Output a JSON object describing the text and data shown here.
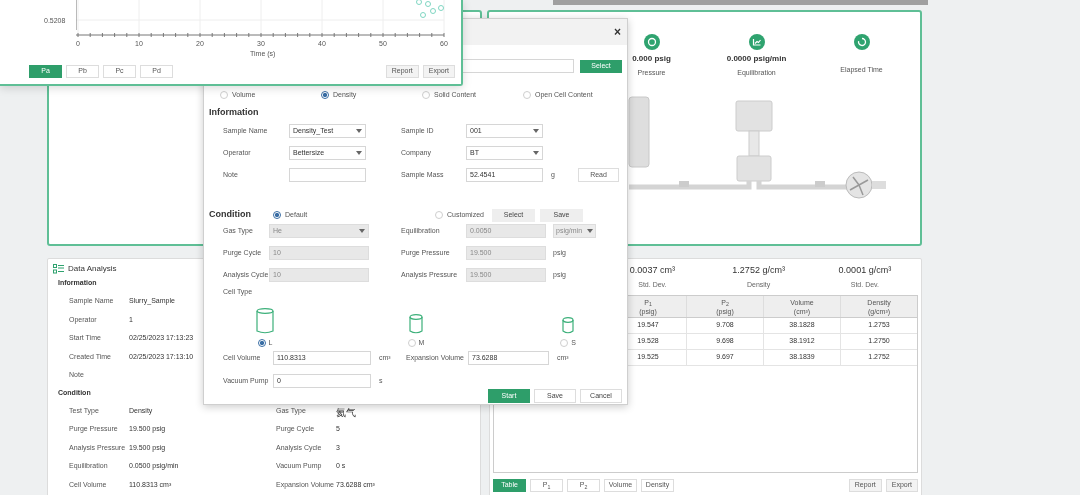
{
  "chart_window": {
    "y_tick_label": "0.5208",
    "x_tick_labels": [
      "0",
      "10",
      "20",
      "30",
      "40",
      "50",
      "60"
    ],
    "x_axis_label": "Time (s)",
    "tabs": [
      {
        "label": "Pa",
        "selected": true
      },
      {
        "label": "Pb",
        "selected": false
      },
      {
        "label": "Pc",
        "selected": false
      },
      {
        "label": "Pd",
        "selected": false
      }
    ],
    "buttons": [
      "Report",
      "Export"
    ]
  },
  "status_panel": {
    "readings": [
      {
        "value": "0.000 psig",
        "label": "Pressure",
        "kind": "gauge"
      },
      {
        "value": "0.0000 psig/min",
        "label": "Equilibration",
        "kind": "trend"
      },
      {
        "label": "Elapsed Time",
        "kind": "timer"
      }
    ]
  },
  "data_analysis": {
    "title": "Data Analysis",
    "information": {
      "heading": "Information",
      "rows": [
        {
          "label": "Sample Name",
          "value": "Slurry_Sample"
        },
        {
          "label": "Operator",
          "value": "1"
        },
        {
          "label": "Start Time",
          "value": "02/25/2023 17:13:23"
        },
        {
          "label": "Created Time",
          "value": "02/25/2023 17:13:10"
        },
        {
          "label": "Note"
        }
      ]
    },
    "condition": {
      "heading": "Condition",
      "left_rows": [
        {
          "label": "Test Type",
          "value": "Density"
        },
        {
          "label": "Purge Pressure",
          "value": "19.500 psig"
        },
        {
          "label": "Analysis Pressure",
          "value": "19.500 psig"
        },
        {
          "label": "Equilibration",
          "value": "0.0500 psig/min"
        },
        {
          "label": "Cell Volume",
          "value": "110.8313 cm³"
        }
      ],
      "right_rows": [
        {
          "label": "Gas Type",
          "value": "氦气"
        },
        {
          "label": "Purge Cycle",
          "value": "5"
        },
        {
          "label": "Analysis Cycle",
          "value": "3"
        },
        {
          "label": "Vacuum Pump",
          "value": "0 s"
        },
        {
          "label": "Expansion Volume",
          "value": "73.6288 cm³"
        }
      ]
    }
  },
  "results_panel": {
    "stats": [
      {
        "value": "0.0037 cm³",
        "label": "Std. Dev."
      },
      {
        "value": "1.2752 g/cm³",
        "label": "Density"
      },
      {
        "value": "0.0001 g/cm³",
        "label": "Std. Dev."
      }
    ],
    "table": {
      "columns": [
        {
          "name": "P$_{1}$",
          "unit": "(psig)"
        },
        {
          "name": "P$_{2}$",
          "unit": "(psig)"
        },
        {
          "name": "Volume",
          "unit": "(cm³)"
        },
        {
          "name": "Density",
          "unit": "(g/cm³)"
        }
      ],
      "rows": [
        [
          "19.547",
          "9.708",
          "38.1828",
          "1.2753"
        ],
        [
          "19.528",
          "9.698",
          "38.1912",
          "1.2750"
        ],
        [
          "19.525",
          "9.697",
          "38.1839",
          "1.2752"
        ]
      ]
    },
    "tabs": [
      {
        "label": "Table",
        "selected": true
      },
      {
        "label": "P$_{1}$",
        "selected": false
      },
      {
        "label": "P$_{2}$",
        "selected": false
      },
      {
        "label": "Volume",
        "selected": false
      },
      {
        "label": "Density",
        "selected": false
      }
    ],
    "buttons": [
      "Report",
      "Export"
    ]
  },
  "dialog": {
    "close": "×",
    "select_button": "Select",
    "test_types": [
      {
        "label": "Volume",
        "selected": false
      },
      {
        "label": "Density",
        "selected": true
      },
      {
        "label": "Solid Content",
        "selected": false
      },
      {
        "label": "Open Cell Content",
        "selected": false
      }
    ],
    "information": {
      "heading": "Information",
      "fields": [
        {
          "label": "Sample Name",
          "value": "Density_Test",
          "kind": "dropdown"
        },
        {
          "label": "Sample ID",
          "value": "001",
          "kind": "dropdown"
        },
        {
          "label": "Operator",
          "value": "Bettersize",
          "kind": "dropdown"
        },
        {
          "label": "Company",
          "value": "BT",
          "kind": "dropdown"
        },
        {
          "label": "Note",
          "kind": "text"
        },
        {
          "label": "Sample Mass",
          "value": "52.4541",
          "kind": "text",
          "unit": "g"
        }
      ],
      "read_button": "Read"
    },
    "condition": {
      "heading": "Condition",
      "modes": [
        {
          "label": "Default",
          "selected": true
        },
        {
          "label": "Customized",
          "selected": false
        }
      ],
      "buttons": [
        "Select",
        "Save"
      ],
      "fields": [
        {
          "label": "Gas Type",
          "value": "He",
          "kind": "dropdown",
          "disabled": true
        },
        {
          "label": "Equilibration",
          "value": "0.0050",
          "kind": "text",
          "disabled": true,
          "unit_dropdown": "psig/min"
        },
        {
          "label": "Purge Cycle",
          "value": "10",
          "kind": "text",
          "disabled": true
        },
        {
          "label": "Purge Pressure",
          "value": "19.500",
          "kind": "text",
          "disabled": true,
          "unit": "psig"
        },
        {
          "label": "Analysis Cycle",
          "value": "10",
          "kind": "text",
          "disabled": true
        },
        {
          "label": "Analysis Pressure",
          "value": "19.500",
          "kind": "text",
          "disabled": true,
          "unit": "psig"
        }
      ],
      "cell_type_label": "Cell Type",
      "cells": [
        {
          "label": "L",
          "selected": true
        },
        {
          "label": "M",
          "selected": false
        },
        {
          "label": "S",
          "selected": false
        }
      ],
      "volume_fields": [
        {
          "label": "Cell Volume",
          "value": "110.8313",
          "unit": "cm³"
        },
        {
          "label": "Expansion Volume",
          "value": "73.6288",
          "unit": "cm³"
        },
        {
          "label": "Vacuum Pump",
          "value": "0",
          "unit": "s"
        }
      ]
    },
    "actions": [
      {
        "label": "Start",
        "kind": "primary"
      },
      {
        "label": "Save",
        "kind": "secondary"
      },
      {
        "label": "Cancel",
        "kind": "secondary"
      }
    ]
  }
}
